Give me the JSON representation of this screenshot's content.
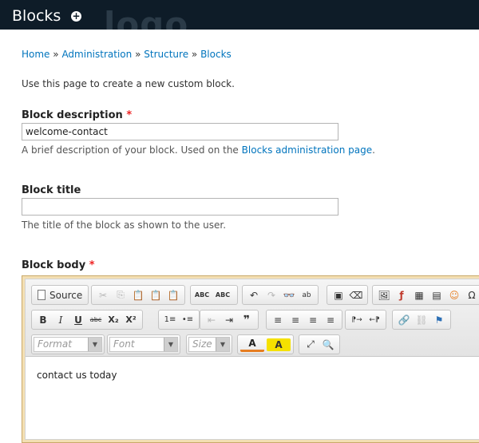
{
  "header": {
    "title": "Blocks",
    "shortcut_symbol": "+",
    "ghost_logo": "logo"
  },
  "breadcrumb": [
    {
      "label": "Home"
    },
    {
      "label": "Administration"
    },
    {
      "label": "Structure"
    },
    {
      "label": "Blocks"
    }
  ],
  "breadcrumb_separator": "»",
  "intro": "Use this page to create a new custom block.",
  "fields": {
    "description": {
      "label": "Block description",
      "required_mark": "*",
      "value": "welcome-contact",
      "help_prefix": "A brief description of your block. Used on the",
      "help_link": "Blocks administration page",
      "help_suffix": "."
    },
    "title": {
      "label": "Block title",
      "value": "",
      "help": "The title of the block as shown to the user."
    },
    "body": {
      "label": "Block body",
      "required_mark": "*",
      "content": "contact us today"
    }
  },
  "editor": {
    "source_label": "Source",
    "format_placeholder": "Format",
    "font_placeholder": "Font",
    "size_placeholder": "Size",
    "icons": {
      "cut": "✂",
      "copy": "⎘",
      "paste": "📋",
      "paste_text": "📋",
      "paste_word": "📋",
      "spellcheck": "ABC",
      "scayt": "ABC",
      "undo": "↶",
      "redo": "↷",
      "find": "👓",
      "replace": "ab",
      "select_all": "▣",
      "remove_format": "⌫",
      "image": "🖼",
      "flash": "ƒ",
      "table": "▦",
      "hr": "▤",
      "smiley": "☺",
      "special": "Ω",
      "bold": "B",
      "italic": "I",
      "underline": "U",
      "strike": "abc",
      "subscript": "X₂",
      "superscript": "X²",
      "ol": "1≡",
      "ul": "•≡",
      "outdent": "⇤",
      "indent": "⇥",
      "blockquote": "❞",
      "align_left": "≡",
      "align_center": "≡",
      "align_right": "≡",
      "justify": "≡",
      "ltr": "⁋→",
      "rtl": "←⁋",
      "link": "🔗",
      "unlink": "⛓",
      "anchor": "⚑",
      "text_color": "A",
      "bg_color": "A",
      "maximize": "⤢",
      "blocks": "🔍"
    }
  },
  "colors": {
    "header_bg": "#0e1c28",
    "link": "#0074bd",
    "required": "#ee2222",
    "editor_frame": "#f3dfb3",
    "bg_color_highlight": "#f5e100"
  }
}
